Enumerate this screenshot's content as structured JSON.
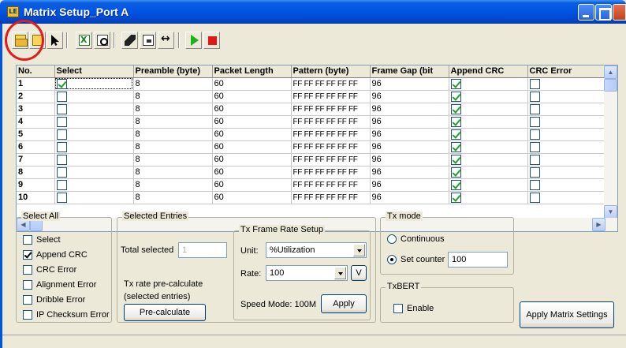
{
  "window": {
    "title": "Matrix Setup_Port A",
    "app_icon": "LE"
  },
  "toolbar": {
    "buttons": [
      "open-file-icon",
      "save-file-icon",
      "cursor-icon",
      "excel-export-icon",
      "find-icon",
      "erase-icon",
      "card-icon",
      "fit-width-icon",
      "play-icon",
      "stop-icon"
    ]
  },
  "grid": {
    "columns": [
      "No.",
      "Select",
      "Preamble (byte)",
      "Packet Length",
      "Pattern (byte)",
      "Frame Gap (bit",
      "Append CRC",
      "CRC Error"
    ],
    "rows": [
      {
        "no": "1",
        "select": true,
        "preamble": "8",
        "length": "60",
        "pattern": "FF FF FF FF FF FF",
        "gap": "96",
        "append_crc": true,
        "crc_error": false
      },
      {
        "no": "2",
        "select": false,
        "preamble": "8",
        "length": "60",
        "pattern": "FF FF FF FF FF FF",
        "gap": "96",
        "append_crc": true,
        "crc_error": false
      },
      {
        "no": "3",
        "select": false,
        "preamble": "8",
        "length": "60",
        "pattern": "FF FF FF FF FF FF",
        "gap": "96",
        "append_crc": true,
        "crc_error": false
      },
      {
        "no": "4",
        "select": false,
        "preamble": "8",
        "length": "60",
        "pattern": "FF FF FF FF FF FF",
        "gap": "96",
        "append_crc": true,
        "crc_error": false
      },
      {
        "no": "5",
        "select": false,
        "preamble": "8",
        "length": "60",
        "pattern": "FF FF FF FF FF FF",
        "gap": "96",
        "append_crc": true,
        "crc_error": false
      },
      {
        "no": "6",
        "select": false,
        "preamble": "8",
        "length": "60",
        "pattern": "FF FF FF FF FF FF",
        "gap": "96",
        "append_crc": true,
        "crc_error": false
      },
      {
        "no": "7",
        "select": false,
        "preamble": "8",
        "length": "60",
        "pattern": "FF FF FF FF FF FF",
        "gap": "96",
        "append_crc": true,
        "crc_error": false
      },
      {
        "no": "8",
        "select": false,
        "preamble": "8",
        "length": "60",
        "pattern": "FF FF FF FF FF FF",
        "gap": "96",
        "append_crc": true,
        "crc_error": false
      },
      {
        "no": "9",
        "select": false,
        "preamble": "8",
        "length": "60",
        "pattern": "FF FF FF FF FF FF",
        "gap": "96",
        "append_crc": true,
        "crc_error": false
      },
      {
        "no": "10",
        "select": false,
        "preamble": "8",
        "length": "60",
        "pattern": "FF FF FF FF FF FF",
        "gap": "96",
        "append_crc": true,
        "crc_error": false
      }
    ]
  },
  "select_all": {
    "title": "Select All",
    "items": [
      {
        "label": "Select",
        "checked": false
      },
      {
        "label": "Append CRC",
        "checked": true
      },
      {
        "label": "CRC Error",
        "checked": false
      },
      {
        "label": "Alignment Error",
        "checked": false
      },
      {
        "label": "Dribble Error",
        "checked": false
      },
      {
        "label": "IP Checksum Error",
        "checked": false
      }
    ]
  },
  "selected_entries": {
    "title": "Selected Entries",
    "total_label": "Total selected",
    "total_value": "1",
    "precalc_text_1": "Tx rate pre-calculate",
    "precalc_text_2": "(selected entries)",
    "precalc_button": "Pre-calculate"
  },
  "tx_frame_rate": {
    "title": "Tx Frame Rate Setup",
    "unit_label": "Unit:",
    "unit_value": "%Utilization",
    "rate_label": "Rate:",
    "rate_value": "100",
    "v_button": "V",
    "speed_mode": "Speed Mode: 100M",
    "apply_button": "Apply"
  },
  "tx_mode": {
    "title": "Tx mode",
    "continuous_label": "Continuous",
    "continuous_selected": false,
    "set_counter_label": "Set counter",
    "set_counter_selected": true,
    "counter_value": "100"
  },
  "txbert": {
    "title": "TxBERT",
    "enable_label": "Enable",
    "enabled": false
  },
  "apply_matrix_button": "Apply Matrix Settings"
}
